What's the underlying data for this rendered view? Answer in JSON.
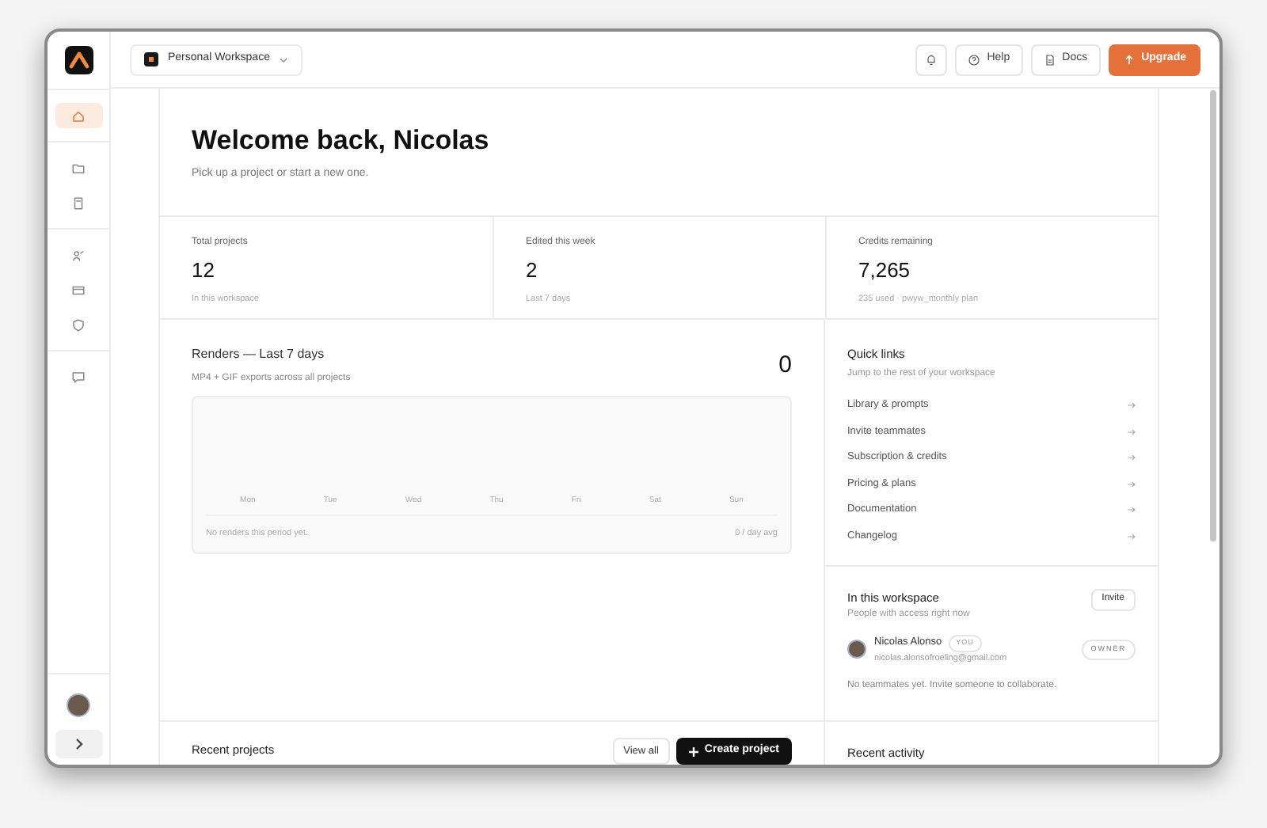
{
  "sidebar": {
    "groups": [
      [
        {
          "selected": true
        }
      ],
      [
        {
          "selected": false
        },
        {
          "selected": false
        }
      ],
      [
        {
          "selected": false
        },
        {
          "selected": false
        },
        {
          "selected": false
        }
      ],
      [
        {
          "selected": false
        }
      ]
    ]
  },
  "topbar": {
    "workspace": "Personal Workspace",
    "buttons": [
      {
        "kind": "bell"
      },
      {
        "kind": "help",
        "label": "Help"
      },
      {
        "kind": "docs",
        "label": "Docs"
      },
      {
        "kind": "upgrade",
        "label": "Upgrade"
      }
    ]
  },
  "hero": {
    "title": "Welcome back, Nicolas",
    "subtitle": "Pick up a project or start a new one."
  },
  "stats": [
    {
      "label": "Total projects",
      "value": "12",
      "note": "In this workspace"
    },
    {
      "label": "Edited this week",
      "value": "2",
      "note": "Last 7 days"
    },
    {
      "label": "Credits remaining",
      "value": "7,265",
      "note": "235 used · pwyw_monthly plan"
    }
  ],
  "renders": {
    "title": "Renders — Last 7 days",
    "subtitle": "MP4 + GIF exports across all projects",
    "total": "0",
    "days": [
      "Mon",
      "Tue",
      "Wed",
      "Thu",
      "Fri",
      "Sat",
      "Sun"
    ],
    "empty_note": "No renders this period yet.",
    "average": "0 / day avg"
  },
  "quick_links": {
    "title": "Quick links",
    "subtitle": "Jump to the rest of your workspace",
    "items": [
      "Library & prompts",
      "Invite teammates",
      "Subscription & credits",
      "Pricing & plans",
      "Documentation",
      "Changelog"
    ]
  },
  "workspace": {
    "title": "In this workspace",
    "subtitle": "People with access right now",
    "invite": "Invite",
    "members": [
      {
        "name": "Nicolas Alonso",
        "badge": "YOU",
        "email": "nicolas.alonsofroeling@gmail.com",
        "role": "OWNER"
      }
    ],
    "note": "No teammates yet. Invite someone to collaborate."
  },
  "recent_projects": {
    "title": "Recent projects",
    "view_all": "View all",
    "create": "Create project"
  },
  "recent_activity": {
    "title": "Recent activity"
  }
}
